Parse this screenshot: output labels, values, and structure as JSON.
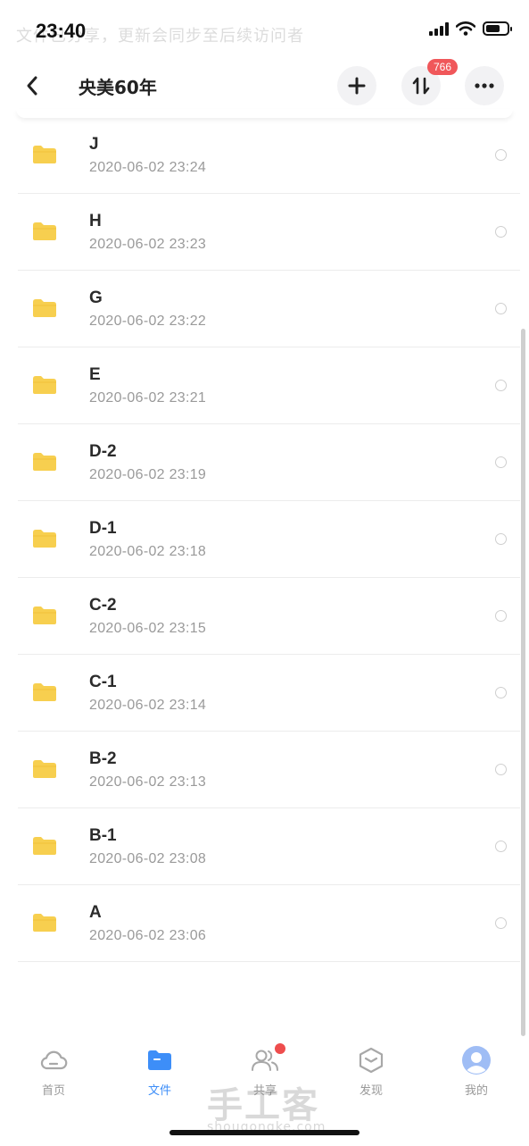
{
  "status_bar": {
    "time": "23:40",
    "background_banner": "文件已分享，更新会同步至后续访问者"
  },
  "header": {
    "title": "央美60年",
    "transfer_badge": "766"
  },
  "files": [
    {
      "name": "J",
      "date": "2020-06-02 23:24"
    },
    {
      "name": "H",
      "date": "2020-06-02 23:23"
    },
    {
      "name": "G",
      "date": "2020-06-02 23:22"
    },
    {
      "name": "E",
      "date": "2020-06-02 23:21"
    },
    {
      "name": "D-2",
      "date": "2020-06-02 23:19"
    },
    {
      "name": "D-1",
      "date": "2020-06-02 23:18"
    },
    {
      "name": "C-2",
      "date": "2020-06-02 23:15"
    },
    {
      "name": "C-1",
      "date": "2020-06-02 23:14"
    },
    {
      "name": "B-2",
      "date": "2020-06-02 23:13"
    },
    {
      "name": "B-1",
      "date": "2020-06-02 23:08"
    },
    {
      "name": "A",
      "date": "2020-06-02 23:06"
    }
  ],
  "tabs": {
    "home": "首页",
    "files": "文件",
    "share": "共享",
    "discover": "发现",
    "me": "我的"
  },
  "watermark": {
    "main": "手工客",
    "sub": "shougongke.com"
  },
  "colors": {
    "accent": "#3d8ef8",
    "folder": "#f7cf4f",
    "badge": "#f0575a"
  }
}
